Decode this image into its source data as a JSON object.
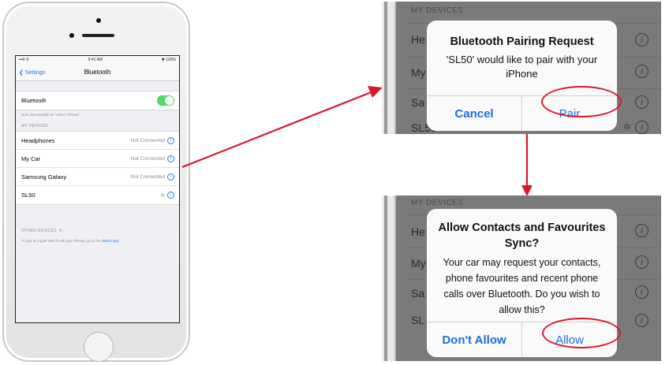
{
  "phone": {
    "status_bar": {
      "signal": "•••ll ✆",
      "time": "9:41 AM",
      "battery": "✱ 100%"
    },
    "nav": {
      "back_label": "Settings",
      "title": "Bluetooth"
    },
    "bluetooth_toggle": {
      "label": "Bluetooth",
      "on": true
    },
    "discoverable_note": "Now discoverable as \"John's iPhone\".",
    "my_devices_header": "MY DEVICES",
    "devices": [
      {
        "name": "Headphones",
        "status": "Not Connected"
      },
      {
        "name": "My Car",
        "status": "Not Connected"
      },
      {
        "name": "Samsung Galaxy",
        "status": "Not Connected"
      },
      {
        "name": "SL50",
        "status": ""
      }
    ],
    "other_devices_header": "OTHER DEVICES",
    "watch_note": "To pair an Apple Watch with your iPhone, go to the",
    "watch_link": "Watch app."
  },
  "dialog_pairing": {
    "background": {
      "header": "MY DEVICES",
      "rows": [
        "He",
        "My",
        "Sa",
        "SL50"
      ]
    },
    "title": "Bluetooth Pairing Request",
    "message": "'SL50' would like to pair with your iPhone",
    "cancel_label": "Cancel",
    "pair_label": "Pair"
  },
  "dialog_contacts": {
    "background": {
      "header": "MY DEVICES",
      "rows": [
        "He",
        "My",
        "Sa",
        "SL"
      ]
    },
    "title": "Allow Contacts and Favourites Sync?",
    "message": "Your car may request your contacts, phone favourites and recent phone calls over Bluetooth. Do you wish to allow this?",
    "dont_allow_label": "Don't Allow",
    "allow_label": "Allow"
  },
  "colors": {
    "accent": "#1a7cf6",
    "toggle_on": "#4cd964",
    "annotation": "#d8182b"
  },
  "icons": [
    "info-icon",
    "spinner-icon",
    "chevron-left-icon"
  ]
}
